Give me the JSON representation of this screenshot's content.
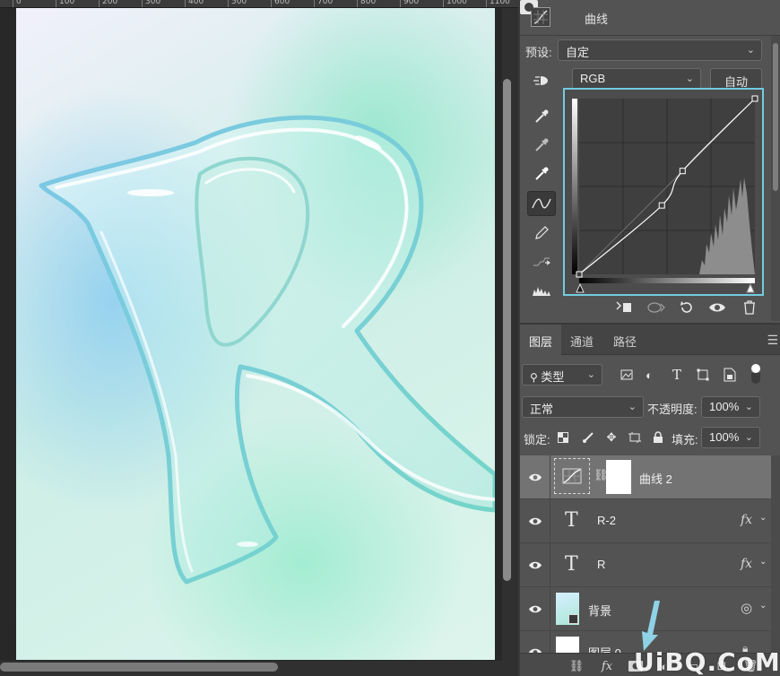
{
  "ruler": {
    "ticks": [
      "0",
      "100",
      "200",
      "300",
      "400",
      "500",
      "600",
      "700",
      "800",
      "900",
      "1000",
      "1100"
    ]
  },
  "properties": {
    "title": "曲线",
    "preset_label": "预设:",
    "preset_value": "自定",
    "channel_value": "RGB",
    "auto_button": "自动"
  },
  "curve": {
    "input_range": [
      0,
      255
    ],
    "output_range": [
      0,
      255
    ],
    "points": [
      [
        0,
        0
      ],
      [
        120,
        100
      ],
      [
        150,
        150
      ],
      [
        255,
        255
      ]
    ]
  },
  "layers": {
    "tabs": [
      "图层",
      "通道",
      "路径"
    ],
    "filter_kind": "类型",
    "blend_mode": "正常",
    "opacity_label": "不透明度:",
    "opacity_value": "100%",
    "lock_label": "锁定:",
    "fill_label": "填充:",
    "fill_value": "100%",
    "rows": [
      {
        "name": "曲线 2",
        "kind": "adjustment"
      },
      {
        "name": "R-2",
        "kind": "text",
        "fx": "fx"
      },
      {
        "name": "R",
        "kind": "text",
        "fx": "fx"
      },
      {
        "name": "背景",
        "kind": "smart-object"
      },
      {
        "name": "图层 0",
        "kind": "pixel"
      }
    ],
    "footer_fx": "fx"
  },
  "watermark": "UiBQ.CoM",
  "colors": {
    "panel_bg": "#535353",
    "selection_highlight": "#74cbe0",
    "selected_row": "#737373"
  }
}
